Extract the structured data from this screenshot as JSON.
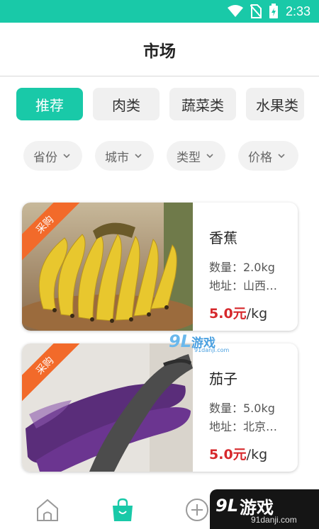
{
  "status_bar": {
    "time": "2:33",
    "icons": [
      "wifi-icon",
      "no-sim-icon",
      "battery-charging-icon"
    ]
  },
  "header": {
    "title": "市场"
  },
  "tabs": [
    {
      "label": "推荐",
      "active": true
    },
    {
      "label": "肉类",
      "active": false
    },
    {
      "label": "蔬菜类",
      "active": false
    },
    {
      "label": "水果类",
      "active": false
    }
  ],
  "filters": [
    {
      "label": "省份"
    },
    {
      "label": "城市"
    },
    {
      "label": "类型"
    },
    {
      "label": "价格"
    }
  ],
  "products": [
    {
      "badge": "采购",
      "name": "香蕉",
      "quantity": "数量：2.0kg",
      "address": "地址：山西…",
      "price": "5.0元",
      "unit": "/kg"
    },
    {
      "badge": "采购",
      "name": "茄子",
      "quantity": "数量：5.0kg",
      "address": "地址：北京…",
      "price": "5.0元",
      "unit": "/kg"
    }
  ],
  "watermark": {
    "text": "游戏",
    "logo": "9L",
    "url": "91danji.com"
  },
  "corner_logo": {
    "text": "游戏",
    "url": "91danji.com",
    "logo": "9L"
  },
  "bottom_nav": [
    {
      "icon": "home-icon",
      "active": false
    },
    {
      "icon": "shopping-bag-icon",
      "active": true
    },
    {
      "icon": "add-circle-icon",
      "active": false
    }
  ],
  "colors": {
    "accent": "#19c9a8",
    "price_red": "#d6282c",
    "badge_orange": "#f26a2a"
  }
}
